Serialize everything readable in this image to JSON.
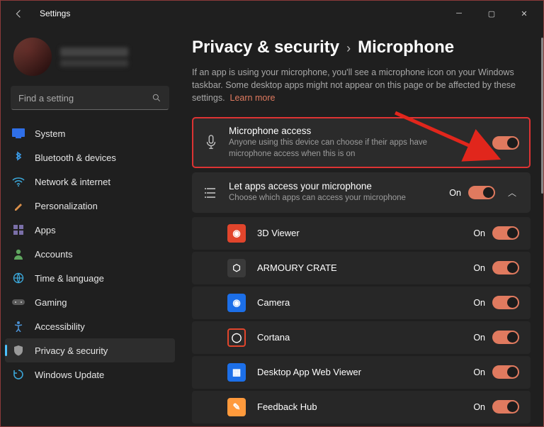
{
  "titlebar": {
    "app_title": "Settings"
  },
  "sidebar": {
    "search_placeholder": "Find a setting",
    "items": [
      {
        "label": "System"
      },
      {
        "label": "Bluetooth & devices"
      },
      {
        "label": "Network & internet"
      },
      {
        "label": "Personalization"
      },
      {
        "label": "Apps"
      },
      {
        "label": "Accounts"
      },
      {
        "label": "Time & language"
      },
      {
        "label": "Gaming"
      },
      {
        "label": "Accessibility"
      },
      {
        "label": "Privacy & security"
      },
      {
        "label": "Windows Update"
      }
    ]
  },
  "breadcrumb": {
    "parent": "Privacy & security",
    "current": "Microphone"
  },
  "intro": {
    "text": "If an app is using your microphone, you'll see a microphone icon on your Windows taskbar. Some desktop apps might not appear on this page or be affected by these settings.",
    "learn_more": "Learn more"
  },
  "cards": {
    "mic_access": {
      "title": "Microphone access",
      "sub": "Anyone using this device can choose if their apps have microphone access when this is on",
      "state": "On"
    },
    "let_apps": {
      "title": "Let apps access your microphone",
      "sub": "Choose which apps can access your microphone",
      "state": "On"
    }
  },
  "apps": [
    {
      "name": "3D Viewer",
      "state": "On",
      "color": "#e1452c",
      "glyph": "◉"
    },
    {
      "name": "ARMOURY CRATE",
      "state": "On",
      "color": "#3a3a3a",
      "glyph": "⬡"
    },
    {
      "name": "Camera",
      "state": "On",
      "color": "#1c6fe8",
      "glyph": "◉"
    },
    {
      "name": "Cortana",
      "state": "On",
      "color": "#2a2a2a",
      "glyph": "◯"
    },
    {
      "name": "Desktop App Web Viewer",
      "state": "On",
      "color": "#1c6fe8",
      "glyph": "▦"
    },
    {
      "name": "Feedback Hub",
      "state": "On",
      "color": "#ff9a3c",
      "glyph": "✎"
    }
  ]
}
